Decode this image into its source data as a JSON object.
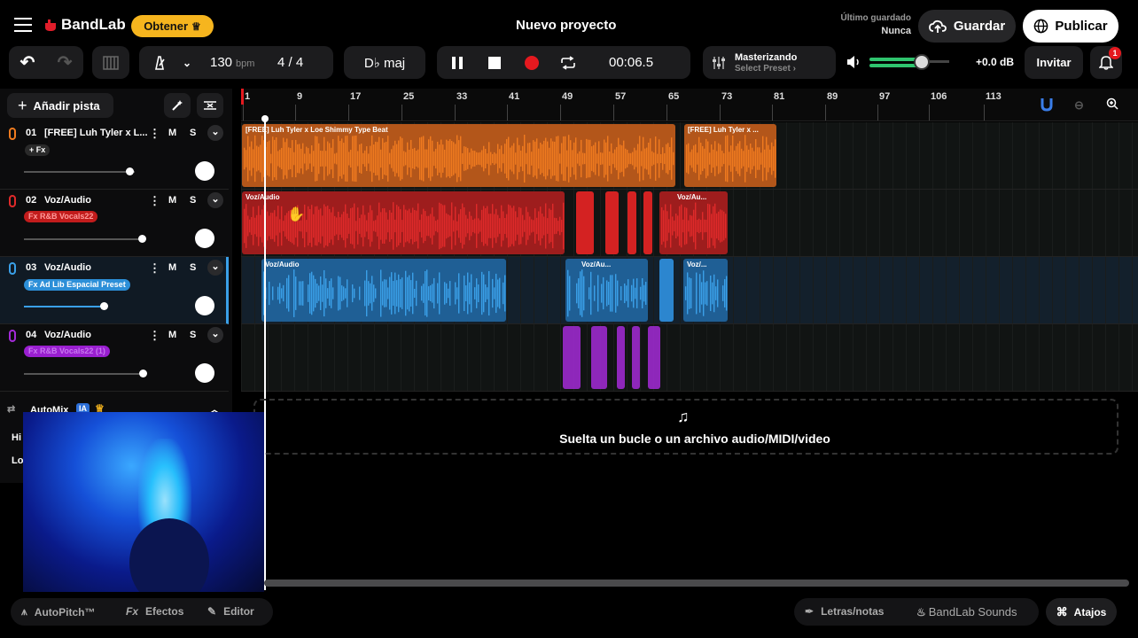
{
  "header": {
    "logo": "BandLab",
    "get_button": "Obtener",
    "project_title": "Nuevo proyecto",
    "last_saved_label": "Último guardado",
    "last_saved_value": "Nunca",
    "save_button": "Guardar",
    "publish_button": "Publicar"
  },
  "transport": {
    "tempo": "130",
    "tempo_unit": "bpm",
    "time_sig": "4 / 4",
    "key": "D♭ maj",
    "time": "00:06.5",
    "mastering_title": "Masterizando",
    "mastering_preset": "Select Preset ›",
    "volume_db": "+0.0 dB",
    "invite_button": "Invitar",
    "notifications_count": "1"
  },
  "sidebar": {
    "add_track": "Añadir pista",
    "tracks": [
      {
        "number": "01",
        "name": "[FREE] Luh Tyler x L...",
        "fx": "+ Fx",
        "mute": "M",
        "solo": "S",
        "color": "#f07b1f",
        "fx_bg": "#2a2a2a"
      },
      {
        "number": "02",
        "name": "Voz/Audio",
        "fx": "Fx R&B Vocals22",
        "mute": "M",
        "solo": "S",
        "color": "#e02a2a",
        "fx_bg": "#c21c1c"
      },
      {
        "number": "03",
        "name": "Voz/Audio",
        "fx": "Fx Ad Lib Espacial Preset",
        "mute": "M",
        "solo": "S",
        "color": "#3aa0e8",
        "fx_bg": "#2c8fd8"
      },
      {
        "number": "04",
        "name": "Voz/Audio",
        "fx": "Fx R&B Vocals22 (1)",
        "mute": "M",
        "solo": "S",
        "color": "#a42ad8",
        "fx_bg": "#9a1fd0"
      }
    ],
    "automix_label": "AutoMix",
    "automix_badge": "IA",
    "row_hi": "Hi",
    "row_lo": "Lo"
  },
  "ruler": {
    "marks": [
      "1",
      "9",
      "17",
      "25",
      "33",
      "41",
      "49",
      "57",
      "65",
      "73",
      "81",
      "89",
      "97",
      "106",
      "113"
    ]
  },
  "clips": {
    "t1a": "[FREE] Luh Tyler x Loe Shimmy Type Beat",
    "t1b": "[FREE] Luh Tyler x ...",
    "t2a": "Voz/Audio",
    "t2b": "Voz/Au...",
    "t3a": "Voz/Audio",
    "t3b": "Voz/Au...",
    "t3c": "Voz/..."
  },
  "dropzone": {
    "text": "Suelta un bucle o un archivo audio/MIDI/video"
  },
  "footer": {
    "autopitch": "AutoPitch™",
    "effects": "Efectos",
    "editor": "Editor",
    "lyrics": "Letras/notas",
    "sounds": "BandLab Sounds",
    "shortcuts": "Atajos"
  },
  "colors": {
    "accent_yellow": "#f6b51e",
    "orange": "#f07b1f",
    "red": "#e02a2a",
    "blue": "#3aa0e8",
    "purple": "#a42ad8",
    "green_meter": "#2fc46e"
  }
}
